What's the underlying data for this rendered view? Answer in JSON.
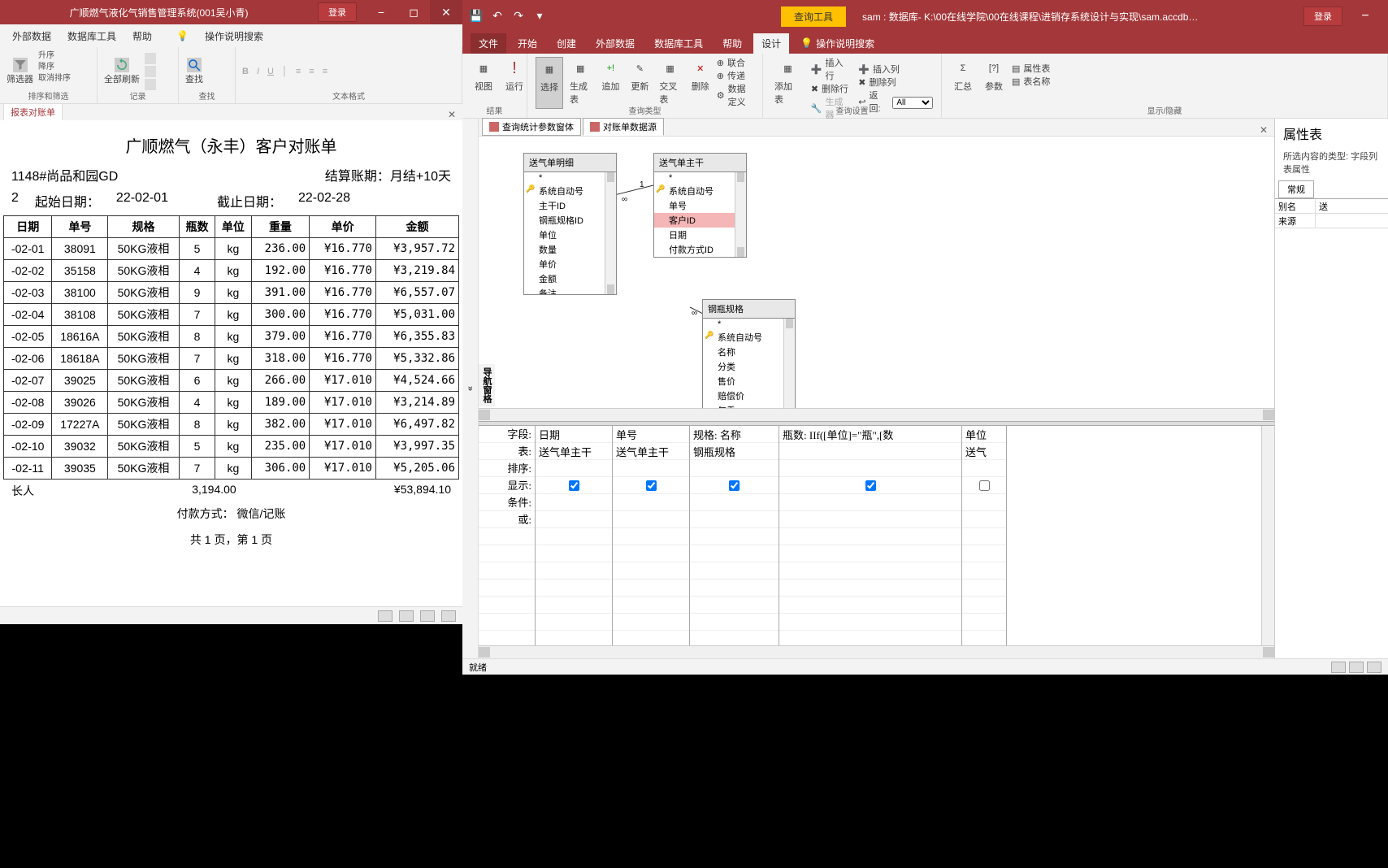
{
  "left": {
    "title": "广顺燃气液化气销售管理系统(001吴小青)",
    "login": "登录",
    "menu": {
      "外部数据": "外部数据",
      "数据库工具": "数据库工具",
      "帮助": "帮助",
      "search": "操作说明搜索"
    },
    "ribbon": {
      "sort": {
        "升序": "升序",
        "降序": "降序",
        "取消排序": "取消排序",
        "筛选器": "筛选器",
        "grp": "排序和筛选"
      },
      "records": {
        "全部刷新": "全部刷新",
        "grp": "记录"
      },
      "find": {
        "查找": "查找",
        "grp": "查找"
      },
      "format": {
        "grp": "文本格式"
      }
    },
    "tab": "报表对账单",
    "report": {
      "title": "广顺燃气（永丰）客户对账单",
      "customer": "1148#尚品和园GD",
      "settle_label": "结算账期：",
      "settle": "月结+10天",
      "seq": "2",
      "start_label": "起始日期：",
      "start": "22-02-01",
      "end_label": "截止日期：",
      "end": "22-02-28",
      "cols": [
        "日期",
        "单号",
        "规格",
        "瓶数",
        "单位",
        "重量",
        "单价",
        "金额"
      ],
      "rows": [
        [
          "-02-01",
          "38091",
          "50KG液相",
          "5",
          "kg",
          "236.00",
          "¥16.770",
          "¥3,957.72"
        ],
        [
          "-02-02",
          "35158",
          "50KG液相",
          "4",
          "kg",
          "192.00",
          "¥16.770",
          "¥3,219.84"
        ],
        [
          "-02-03",
          "38100",
          "50KG液相",
          "9",
          "kg",
          "391.00",
          "¥16.770",
          "¥6,557.07"
        ],
        [
          "-02-04",
          "38108",
          "50KG液相",
          "7",
          "kg",
          "300.00",
          "¥16.770",
          "¥5,031.00"
        ],
        [
          "-02-05",
          "18616A",
          "50KG液相",
          "8",
          "kg",
          "379.00",
          "¥16.770",
          "¥6,355.83"
        ],
        [
          "-02-06",
          "18618A",
          "50KG液相",
          "7",
          "kg",
          "318.00",
          "¥16.770",
          "¥5,332.86"
        ],
        [
          "-02-07",
          "39025",
          "50KG液相",
          "6",
          "kg",
          "266.00",
          "¥17.010",
          "¥4,524.66"
        ],
        [
          "-02-08",
          "39026",
          "50KG液相",
          "4",
          "kg",
          "189.00",
          "¥17.010",
          "¥3,214.89"
        ],
        [
          "-02-09",
          "17227A",
          "50KG液相",
          "8",
          "kg",
          "382.00",
          "¥17.010",
          "¥6,497.82"
        ],
        [
          "-02-10",
          "39032",
          "50KG液相",
          "5",
          "kg",
          "235.00",
          "¥17.010",
          "¥3,997.35"
        ],
        [
          "-02-11",
          "39035",
          "50KG液相",
          "7",
          "kg",
          "306.00",
          "¥17.010",
          "¥5,205.06"
        ]
      ],
      "maker": "长人",
      "total_qty": "3,194.00",
      "total_amt": "¥53,894.10",
      "pay_label": "付款方式：",
      "pay": "微信/记账",
      "page": "共 1 页，第 1 页"
    }
  },
  "right": {
    "qat_title_context": "查询工具",
    "title": "sam : 数据库- K:\\00在线学院\\00在线课程\\进销存系统设计与实现\\sam.accdb…",
    "login": "登录",
    "menu": {
      "文件": "文件",
      "开始": "开始",
      "创建": "创建",
      "外部数据": "外部数据",
      "数据库工具": "数据库工具",
      "帮助": "帮助",
      "设计": "设计",
      "search": "操作说明搜索"
    },
    "ribbon": {
      "结果": {
        "视图": "视图",
        "运行": "运行",
        "grp": "结果"
      },
      "查询类型": {
        "选择": "选择",
        "生成表": "生成表",
        "追加": "追加",
        "更新": "更新",
        "交叉表": "交叉表",
        "删除": "删除",
        "联合": "联合",
        "传递": "传递",
        "数据定义": "数据定义",
        "grp": "查询类型"
      },
      "查询设置": {
        "添加表": "添加表",
        "插入行": "插入行",
        "删除行": "删除行",
        "生成器": "生成器",
        "插入列": "插入列",
        "删除列": "删除列",
        "返回": "返回:",
        "return_val": "All",
        "grp": "查询设置"
      },
      "显示隐藏": {
        "汇总": "汇总",
        "参数": "参数",
        "属性表": "属性表",
        "表名称": "表名称",
        "grp": "显示/隐藏"
      }
    },
    "tabs": {
      "t1": "查询统计参数窗体",
      "t2": "对账单数据源"
    },
    "tables": {
      "送气单明细": {
        "title": "送气单明细",
        "fields": [
          "*",
          "系统自动号",
          "主干ID",
          "钢瓶规格ID",
          "单位",
          "数量",
          "单价",
          "金额",
          "备注"
        ],
        "pk": "系统自动号"
      },
      "送气单主干": {
        "title": "送气单主干",
        "fields": [
          "*",
          "系统自动号",
          "单号",
          "客户ID",
          "日期",
          "付款方式ID"
        ],
        "pk": "系统自动号",
        "selected": "客户ID"
      },
      "钢瓶规格": {
        "title": "钢瓶规格",
        "fields": [
          "*",
          "系统自动号",
          "名称",
          "分类",
          "售价",
          "赔偿价",
          "气重"
        ],
        "pk": "系统自动号"
      }
    },
    "vert_label": "导航窗格",
    "grid": {
      "labels": {
        "字段": "字段:",
        "表": "表:",
        "排序": "排序:",
        "显示": "显示:",
        "条件": "条件:",
        "或": "或:"
      },
      "cols": [
        {
          "field": "日期",
          "table": "送气单主干",
          "show": true
        },
        {
          "field": "单号",
          "table": "送气单主干",
          "show": true
        },
        {
          "field": "规格: 名称",
          "table": "钢瓶规格",
          "show": true
        },
        {
          "field": "瓶数: IIf([单位]=\"瓶\",[数",
          "table": "",
          "show": true
        },
        {
          "field": "单位",
          "table": "送气",
          "show": false
        }
      ]
    },
    "props": {
      "title": "属性表",
      "sub": "所选内容的类型: 字段列表属性",
      "tab": "常规",
      "rows": [
        {
          "k": "别名",
          "v": "送"
        },
        {
          "k": "来源",
          "v": ""
        }
      ]
    },
    "status": "就绪"
  },
  "chart_data": {
    "type": "table",
    "title": "广顺燃气（永丰）客户对账单",
    "columns": [
      "日期",
      "单号",
      "规格",
      "瓶数",
      "单位",
      "重量",
      "单价",
      "金额"
    ],
    "rows": [
      [
        "-02-01",
        "38091",
        "50KG液相",
        5,
        "kg",
        236.0,
        16.77,
        3957.72
      ],
      [
        "-02-02",
        "35158",
        "50KG液相",
        4,
        "kg",
        192.0,
        16.77,
        3219.84
      ],
      [
        "-02-03",
        "38100",
        "50KG液相",
        9,
        "kg",
        391.0,
        16.77,
        6557.07
      ],
      [
        "-02-04",
        "38108",
        "50KG液相",
        7,
        "kg",
        300.0,
        16.77,
        5031.0
      ],
      [
        "-02-05",
        "18616A",
        "50KG液相",
        8,
        "kg",
        379.0,
        16.77,
        6355.83
      ],
      [
        "-02-06",
        "18618A",
        "50KG液相",
        7,
        "kg",
        318.0,
        16.77,
        5332.86
      ],
      [
        "-02-07",
        "39025",
        "50KG液相",
        6,
        "kg",
        266.0,
        17.01,
        4524.66
      ],
      [
        "-02-08",
        "39026",
        "50KG液相",
        4,
        "kg",
        189.0,
        17.01,
        3214.89
      ],
      [
        "-02-09",
        "17227A",
        "50KG液相",
        8,
        "kg",
        382.0,
        17.01,
        6497.82
      ],
      [
        "-02-10",
        "39032",
        "50KG液相",
        5,
        "kg",
        235.0,
        17.01,
        3997.35
      ],
      [
        "-02-11",
        "39035",
        "50KG液相",
        7,
        "kg",
        306.0,
        17.01,
        5205.06
      ]
    ],
    "totals": {
      "重量": 3194.0,
      "金额": 53894.1
    }
  }
}
